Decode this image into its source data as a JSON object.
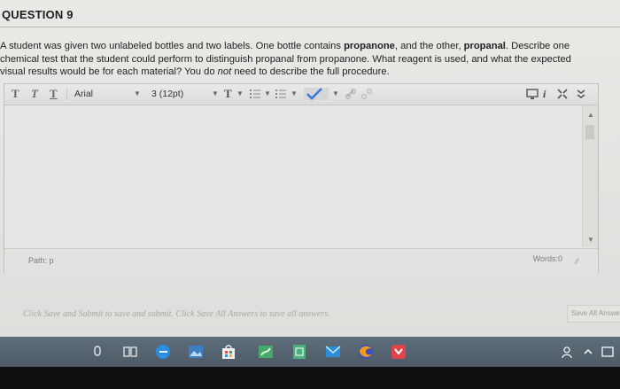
{
  "question": {
    "title": "QUESTION 9",
    "line1_a": "A student was given two unlabeled bottles and two labels. One bottle contains ",
    "line1_b": "propanone",
    "line1_c": ", and the other, ",
    "line1_d": "propanal",
    "line1_e": ". Describe one",
    "line2": "chemical test that the student could perform to distinguish propanal from propanone. What reagent is used, and what the expected",
    "line3_a": "visual results would be for each material? You do ",
    "line3_b": "not",
    "line3_c": " need to describe the full procedure."
  },
  "toolbar": {
    "t1": "T",
    "t2": "T",
    "t3": "T",
    "font": "Arial",
    "size": "3 (12pt)",
    "color_t": "T"
  },
  "editor": {
    "path_label": "Path: p",
    "words_label": "Words:0"
  },
  "footer": {
    "hint": "Click Save and Submit to save and submit. Click Save All Answers to save all answers.",
    "save_all": "Save All Answers"
  },
  "colors": {
    "accent_check": "#3b7bd4",
    "taskbar": "#55636f"
  }
}
